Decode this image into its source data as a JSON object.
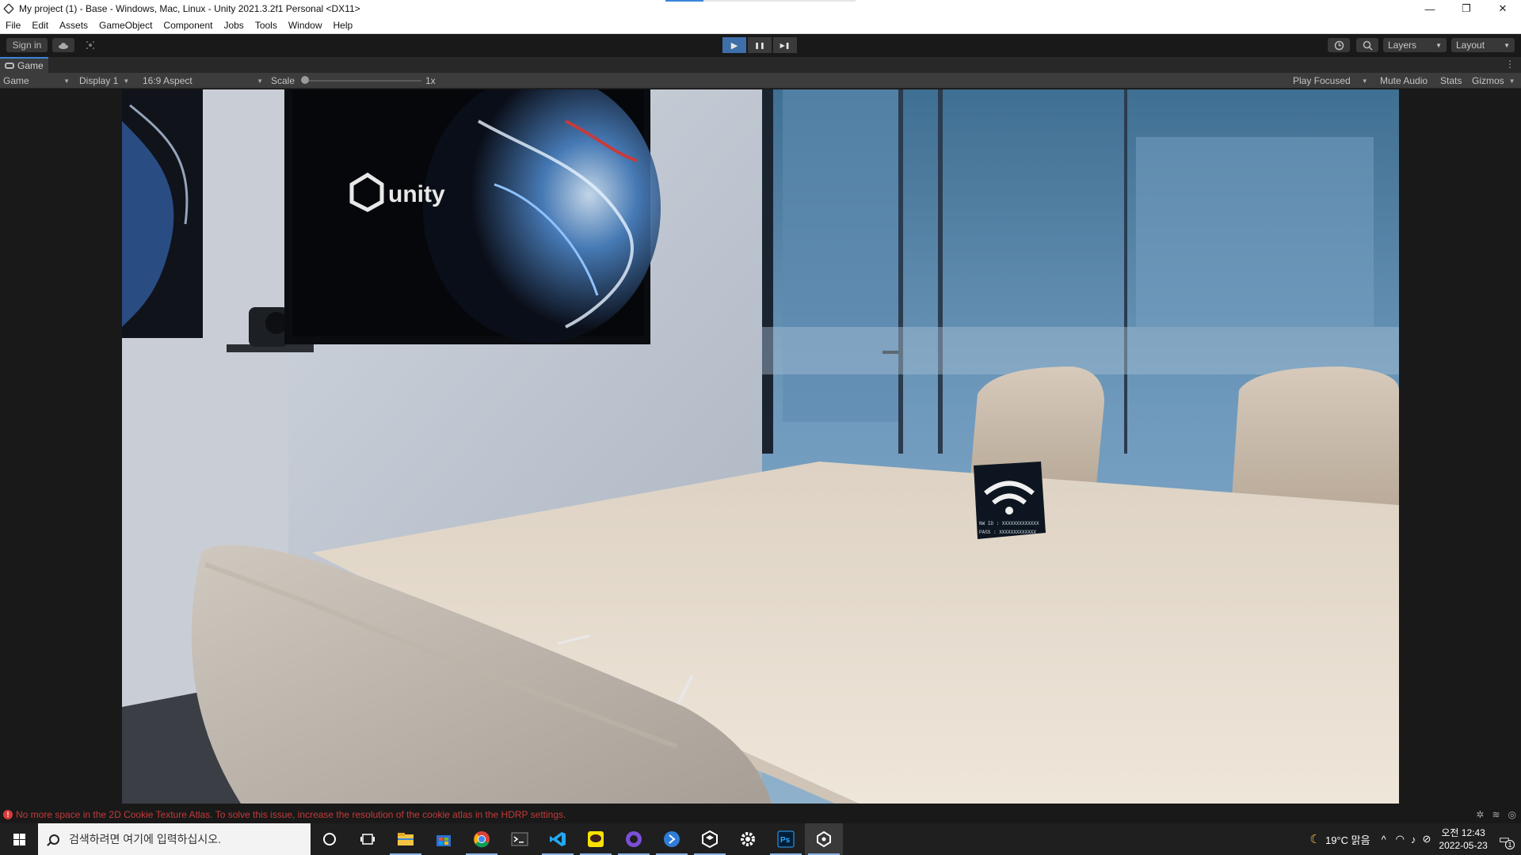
{
  "window": {
    "title": "My project (1) - Base - Windows, Mac, Linux - Unity 2021.3.2f1 Personal <DX11>",
    "controls": {
      "minimize": "—",
      "restore": "❐",
      "close": "✕"
    }
  },
  "menu": [
    "File",
    "Edit",
    "Assets",
    "GameObject",
    "Component",
    "Jobs",
    "Tools",
    "Window",
    "Help"
  ],
  "toolbar": {
    "sign_in": "Sign in",
    "play": "▶",
    "pause": "❚❚",
    "step": "▶❚",
    "layers": "Layers",
    "layout": "Layout"
  },
  "game_tab": {
    "label": "Game",
    "more": "⋮"
  },
  "game_toolbar": {
    "view": "Game",
    "display": "Display 1",
    "aspect": "16:9 Aspect",
    "scale_label": "Scale",
    "scale_value": "1x",
    "scale_level": 0.0,
    "play_mode": "Play Focused",
    "mute_audio": "Mute Audio",
    "stats": "Stats",
    "gizmos": "Gizmos"
  },
  "scene": {
    "tv_logo_text": "unity",
    "sign_line_1": "NW ID : XXXXXXXXXXXXX",
    "sign_line_2": "PASS : XXXXXXXXXXXXX"
  },
  "status": {
    "message": "No more space in the 2D Cookie Texture Atlas. To solve this issue, increase the resolution of the cookie atlas in the HDRP settings."
  },
  "taskbar": {
    "search_placeholder": "검색하려면 여기에 입력하십시오.",
    "weather": "19°C 맑음",
    "time": "오전 12:43",
    "date": "2022-05-23",
    "notification_count": "1",
    "apps": [
      "cortana-icon",
      "task-view-icon",
      "file-explorer-icon",
      "store-icon",
      "chrome-icon",
      "terminal-icon",
      "vscode-icon",
      "kakaotalk-icon",
      "github-desktop-icon",
      "sourcetree-icon",
      "unity-hub-icon",
      "settings-icon",
      "photoshop-icon",
      "unity-editor-icon"
    ]
  },
  "colors": {
    "accent": "#3a86d8",
    "play_active": "#3e6fa8",
    "error": "#d83a3a",
    "editor_bg": "#191919"
  }
}
